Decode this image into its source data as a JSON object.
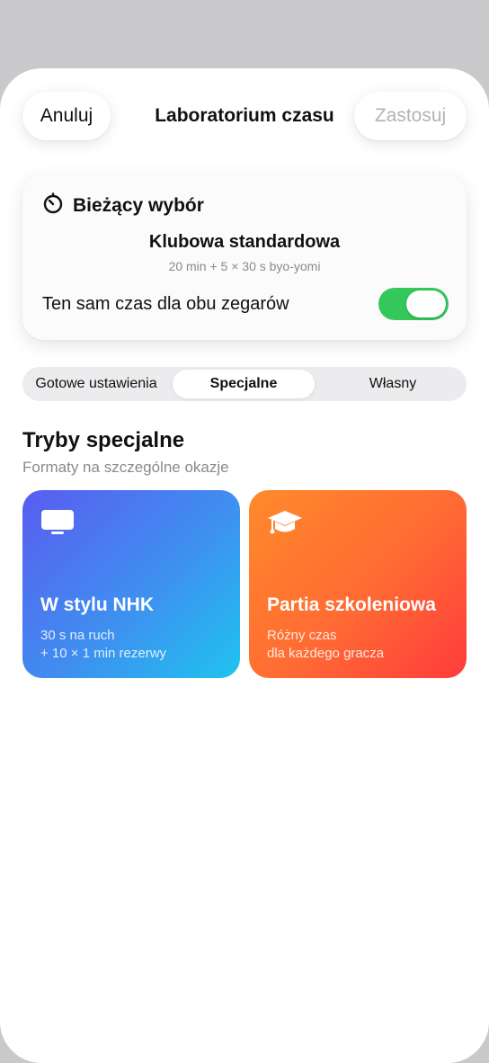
{
  "nav": {
    "cancel_label": "Anuluj",
    "title": "Laboratorium czasu",
    "apply_label": "Zastosuj"
  },
  "current": {
    "heading": "Bieżący wybór",
    "icon": "timer-icon",
    "preset_name": "Klubowa standardowa",
    "preset_desc": "20 min + 5 × 30 s byo-yomi",
    "same_time_label": "Ten sam czas dla obu zegarów",
    "same_time_on": true
  },
  "tabs": [
    {
      "label": "Gotowe ustawienia",
      "selected": false
    },
    {
      "label": "Specjalne",
      "selected": true
    },
    {
      "label": "Własny",
      "selected": false
    }
  ],
  "section": {
    "title": "Tryby specjalne",
    "subtitle": "Formaty na szczególne okazje"
  },
  "modes": [
    {
      "icon": "tv-icon",
      "title": "W stylu NHK",
      "line1": "30 s na ruch",
      "line2": "+ 10 × 1 min rezerwy"
    },
    {
      "icon": "graduation-cap-icon",
      "title": "Partia szkoleniowa",
      "line1": "Różny czas",
      "line2": "dla każdego gracza"
    }
  ],
  "colors": {
    "toggle_on": "#34c759",
    "nhk_gradient": [
      "#5a5cf0",
      "#1fc3ee"
    ],
    "training_gradient": [
      "#ff8a2a",
      "#ff3b3b"
    ],
    "apply_disabled": "#b3b3b6"
  }
}
